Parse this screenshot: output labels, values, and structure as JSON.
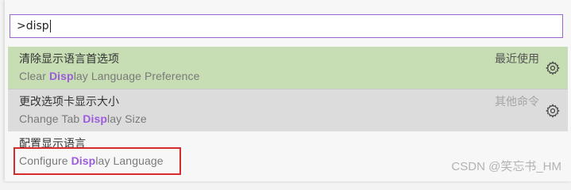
{
  "command_palette": {
    "input_prefix": ">",
    "input_value": "disp",
    "items": [
      {
        "title": "清除显示语言首选项",
        "subtitle_pre": "Clear ",
        "subtitle_match": "Disp",
        "subtitle_post": "lay Language Preference",
        "group_label": "最近使用",
        "gear_icon": "gear-icon"
      },
      {
        "title": "更改选项卡显示大小",
        "subtitle_pre": "Change Tab ",
        "subtitle_match": "Disp",
        "subtitle_post": "lay Size",
        "group_label": "其他命令",
        "gear_icon": "gear-icon"
      },
      {
        "title": "配置显示语言",
        "subtitle_pre": "Configure ",
        "subtitle_match": "Disp",
        "subtitle_post": "lay Language"
      }
    ]
  },
  "watermark": "CSDN @笑忘书_HM",
  "colors": {
    "focus_border": "#9a63cf",
    "match_highlight": "#9b5bdc",
    "selected_row": "#c7ddb4",
    "hover_row": "#dcdcdc",
    "annotation_box": "#d62b2b"
  }
}
